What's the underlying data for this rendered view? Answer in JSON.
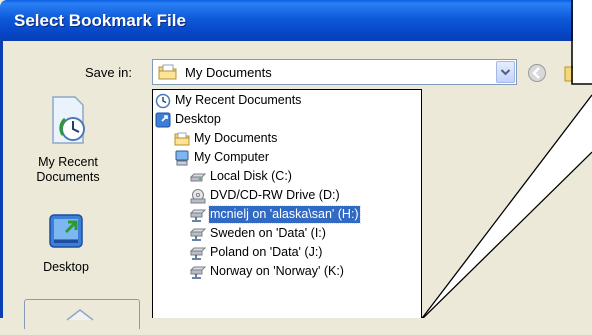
{
  "window": {
    "title": "Select Bookmark File"
  },
  "toolbar": {
    "save_in_label": "Save in:",
    "location_value": "My Documents",
    "combo_icon": "folder-documents-icon",
    "back_icon": "back-arrow-icon",
    "up_icon": "up-folder-icon"
  },
  "places": [
    {
      "label": "My Recent Documents",
      "icon": "recent-documents-icon"
    },
    {
      "label": "Desktop",
      "icon": "desktop-icon"
    },
    {
      "label": "",
      "icon": "my-documents-icon"
    }
  ],
  "places_labels": {
    "recent_line1": "My Recent",
    "recent_line2": "Documents",
    "desktop": "Desktop"
  },
  "dropdown": {
    "items": [
      {
        "label": "My Recent Documents",
        "icon": "recent-documents-icon",
        "indent": 0
      },
      {
        "label": "Desktop",
        "icon": "desktop-icon",
        "indent": 0
      },
      {
        "label": "My Documents",
        "icon": "folder-documents-icon",
        "indent": 1
      },
      {
        "label": "My Computer",
        "icon": "computer-icon",
        "indent": 1
      },
      {
        "label": "Local Disk (C:)",
        "icon": "hard-disk-icon",
        "indent": 2
      },
      {
        "label": "DVD/CD-RW Drive (D:)",
        "icon": "cd-drive-icon",
        "indent": 2
      },
      {
        "label": "mcnielj on 'alaska\\san' (H:)",
        "icon": "network-drive-icon",
        "indent": 2,
        "selected": true
      },
      {
        "label": "Sweden on 'Data' (I:)",
        "icon": "network-drive-icon",
        "indent": 2
      },
      {
        "label": "Poland on 'Data' (J:)",
        "icon": "network-drive-icon",
        "indent": 2
      },
      {
        "label": "Norway on 'Norway' (K:)",
        "icon": "network-drive-icon",
        "indent": 2
      }
    ]
  },
  "colors": {
    "titlebar": "#0A5FE3",
    "dialog_bg": "#ECE9D8",
    "selection": "#316AC5"
  }
}
